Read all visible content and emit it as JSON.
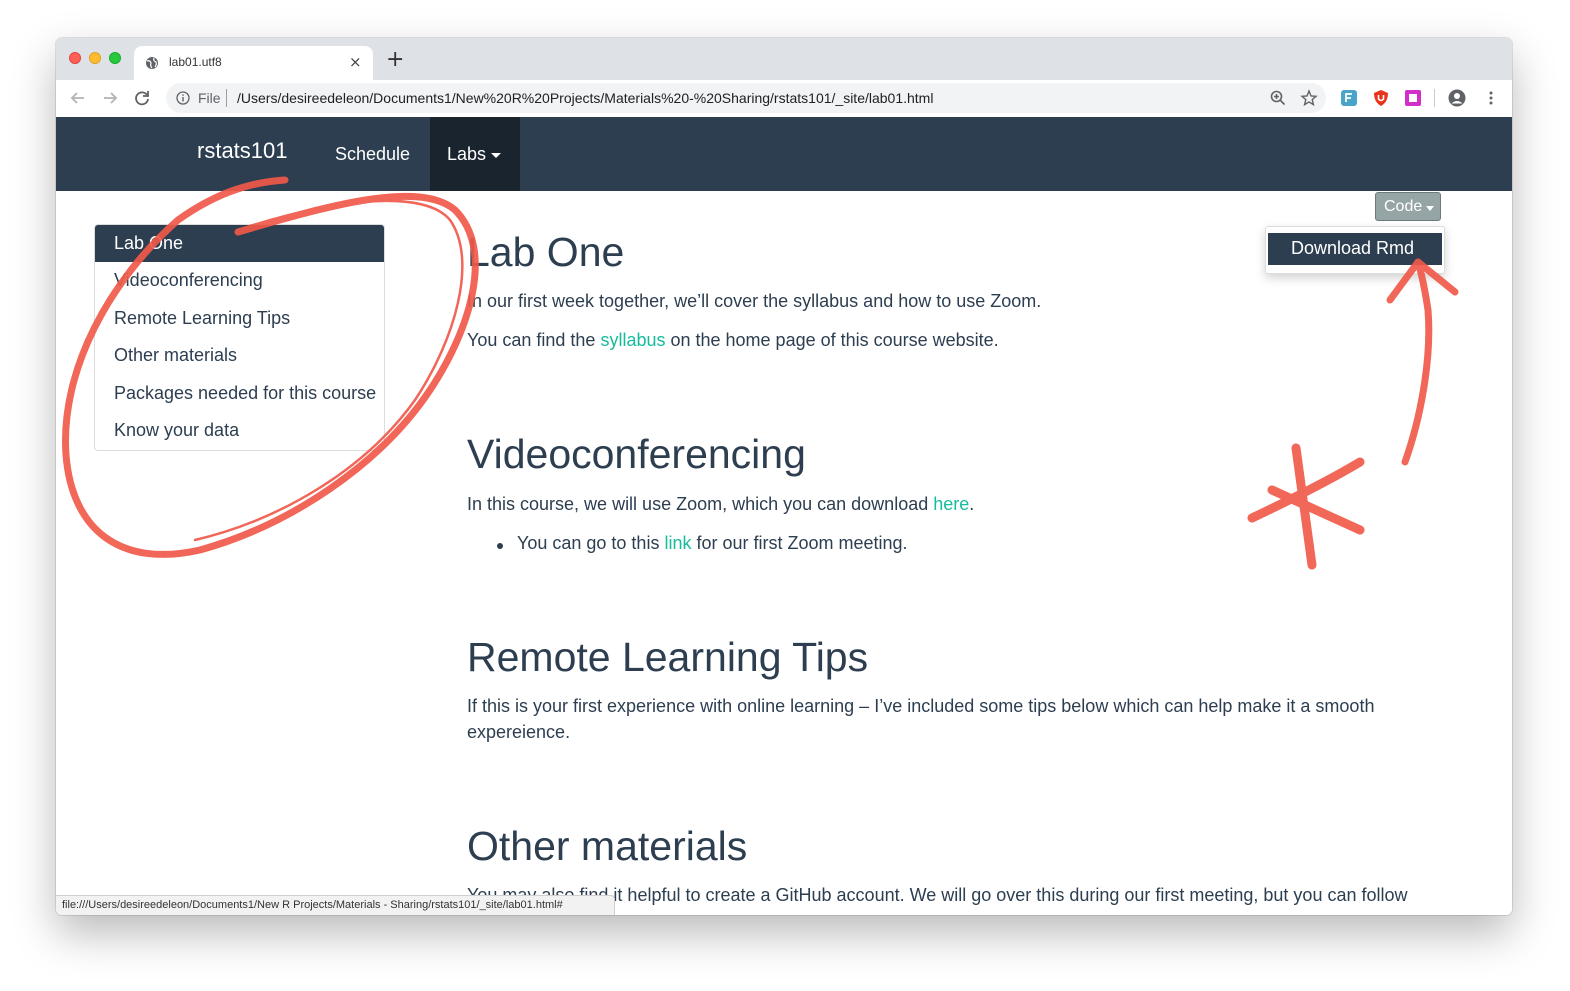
{
  "browser": {
    "tab_title": "lab01.utf8",
    "url_scheme_label": "File",
    "url": "/Users/desireedeleon/Documents1/New%20R%20Projects/Materials%20-%20Sharing/rstats101/_site/lab01.html",
    "status_url": "file:///Users/desireedeleon/Documents1/New R Projects/Materials - Sharing/rstats101/_site/lab01.html#",
    "new_tab_glyph": "+",
    "close_glyph": "×"
  },
  "navbar": {
    "brand": "rstats101",
    "schedule": "Schedule",
    "labs": "Labs",
    "background": "#2c3e50",
    "active_background": "#1a242f"
  },
  "toc": {
    "items": [
      {
        "label": "Lab One",
        "active": true
      },
      {
        "label": "Videoconferencing"
      },
      {
        "label": "Remote Learning Tips"
      },
      {
        "label": "Other materials"
      },
      {
        "label": "Packages needed for this course"
      },
      {
        "label": "Know your data"
      }
    ]
  },
  "code_menu": {
    "button": "Code",
    "download": "Download Rmd"
  },
  "sections": {
    "lab_one": {
      "title": "Lab One",
      "p1": "In our first week together, we’ll cover the syllabus and how to use Zoom.",
      "p2_before": "You can find the ",
      "p2_link": "syllabus",
      "p2_after": " on the home page of this course website."
    },
    "video": {
      "title": "Videoconferencing",
      "p1_before": "In this course, we will use Zoom, which you can download ",
      "p1_link": "here",
      "p1_after": ".",
      "bullet_before": "You can go to this ",
      "bullet_link": "link",
      "bullet_after": " for our first Zoom meeting."
    },
    "remote": {
      "title": "Remote Learning Tips",
      "p1_line1": "If this is your first experience with online learning – I’ve included some tips below which can help make it a smooth",
      "p1_line2": "expereience."
    },
    "other": {
      "title": "Other materials",
      "p1": "You may also find it helpful to create a GitHub account. We will go over this during our first meeting, but you can follow"
    }
  },
  "colors": {
    "link": "#18bc9c",
    "text": "#2c3e50",
    "annotation": "#f05a4a"
  }
}
